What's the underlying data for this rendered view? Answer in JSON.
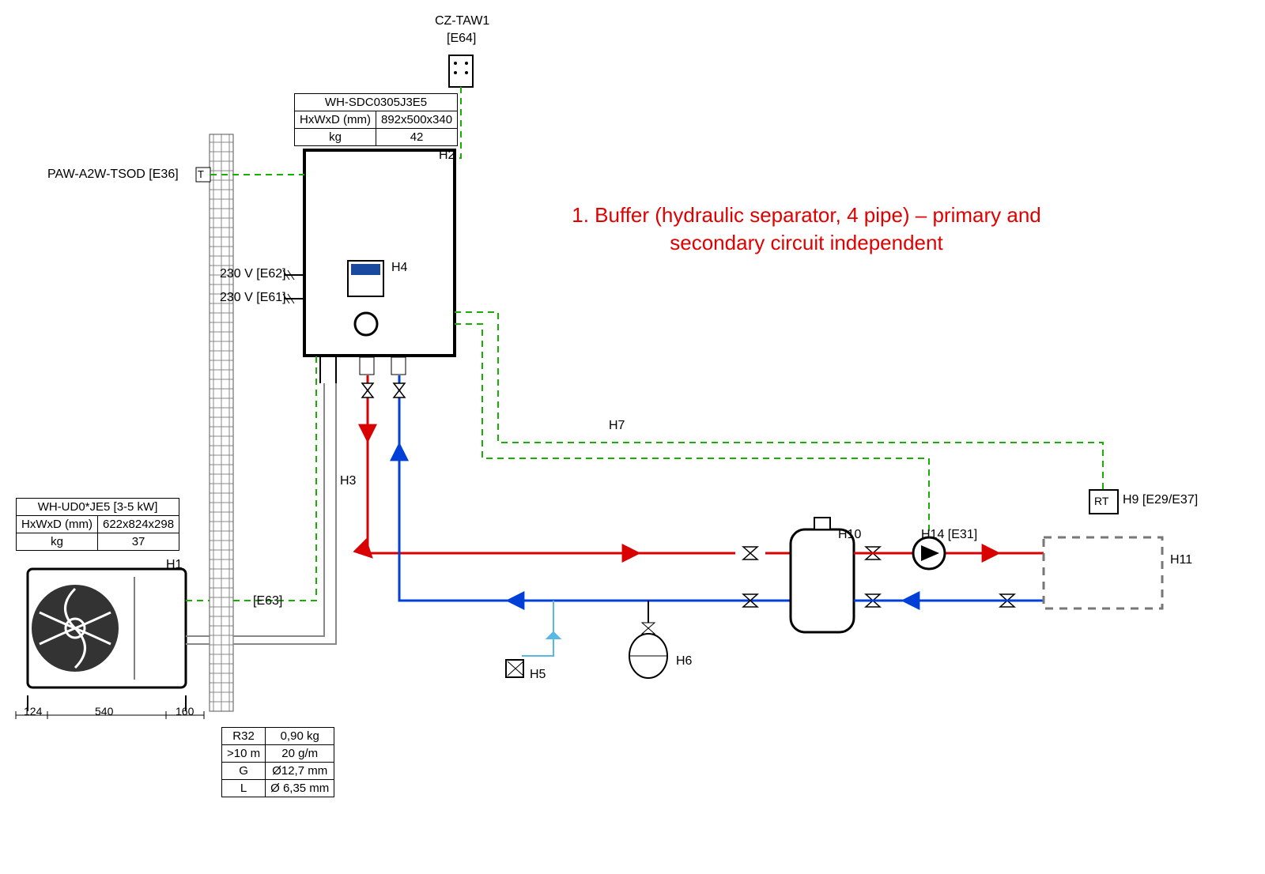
{
  "title_note": "1. Buffer (hydraulic separator, 4 pipe) – primary and secondary circuit independent",
  "labels": {
    "cz_taw1": "CZ-TAW1",
    "cz_taw1_e": "[E64]",
    "paw": "PAW-A2W-TSOD [E36]",
    "e62": "230 V [E62]",
    "e61": "230 V [E61]",
    "e63": "[E63]",
    "H1": "H1",
    "H2": "H2",
    "H3": "H3",
    "H4": "H4",
    "H5": "H5",
    "H6": "H6",
    "H7": "H7",
    "H9": "H9 [E29/E37]",
    "H10": "H10",
    "H11": "H11",
    "H14": "H14 [E31]",
    "rt": "RT",
    "t": "T"
  },
  "indoor_spec": {
    "model": "WH-SDC0305J3E5",
    "dim_label": "HxWxD (mm)",
    "dim_value": "892x500x340",
    "kg_label": "kg",
    "kg_value": "42"
  },
  "outdoor_spec": {
    "model": "WH-UD0*JE5 [3-5 kW]",
    "dim_label": "HxWxD (mm)",
    "dim_value": "622x824x298",
    "kg_label": "kg",
    "kg_value": "37"
  },
  "pipe_spec": {
    "r1c1": "R32",
    "r1c2": "0,90 kg",
    "r2c1": ">10 m",
    "r2c2": "20 g/m",
    "r3c1": "G",
    "r3c2": "Ø12,7 mm",
    "r4c1": "L",
    "r4c2": "Ø 6,35 mm"
  },
  "dims": {
    "d1": "124",
    "d2": "540",
    "d3": "160"
  }
}
